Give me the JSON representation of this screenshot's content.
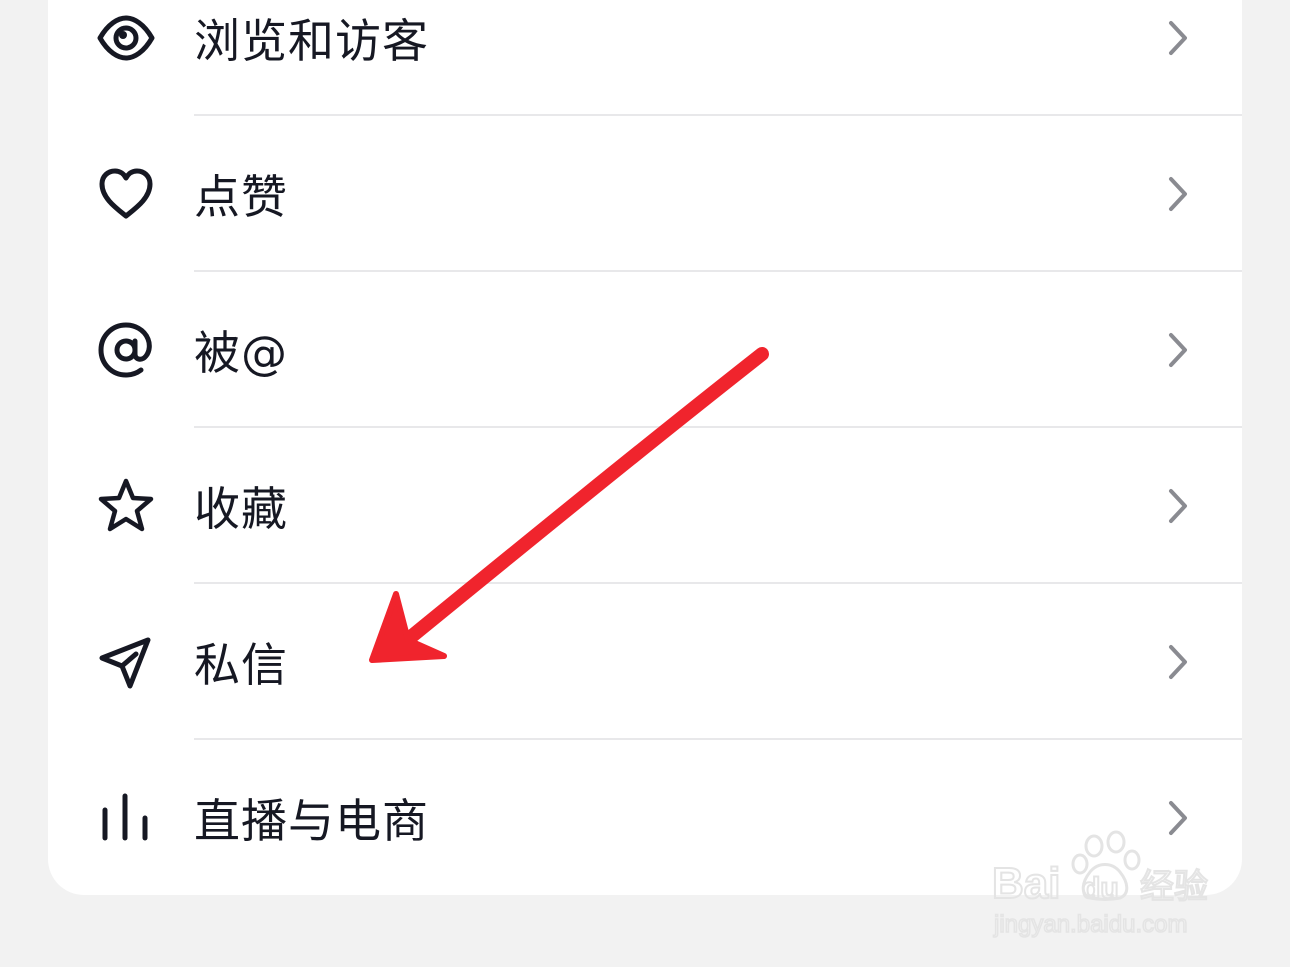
{
  "menu": {
    "items": [
      {
        "label": "浏览和访客",
        "icon": "eye-icon"
      },
      {
        "label": "点赞",
        "icon": "heart-icon"
      },
      {
        "label": "被@",
        "icon": "at-icon"
      },
      {
        "label": "收藏",
        "icon": "star-icon"
      },
      {
        "label": "私信",
        "icon": "paper-plane-icon"
      },
      {
        "label": "直播与电商",
        "icon": "bar-chart-icon"
      }
    ],
    "chevron_icon": "chevron-right-icon"
  },
  "annotation": {
    "arrow_color": "#f0242d",
    "points_to": "私信"
  },
  "watermark": {
    "brand": "Baidu经验",
    "url": "jingyan.baidu.com"
  },
  "colors": {
    "background": "#f2f2f2",
    "card": "#ffffff",
    "text": "#161823",
    "divider": "#e8e8ea",
    "chevron": "#8a8b91"
  }
}
